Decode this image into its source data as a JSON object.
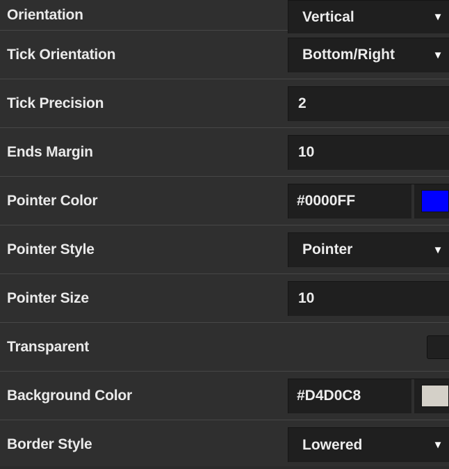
{
  "properties": [
    {
      "label": "Orientation",
      "type": "select",
      "value": "Vertical"
    },
    {
      "label": "Tick Orientation",
      "type": "select",
      "value": "Bottom/Right"
    },
    {
      "label": "Tick Precision",
      "type": "input",
      "value": "2"
    },
    {
      "label": "Ends Margin",
      "type": "input",
      "value": "10"
    },
    {
      "label": "Pointer Color",
      "type": "color",
      "value": "#0000FF",
      "swatch": "#0000FF"
    },
    {
      "label": "Pointer Style",
      "type": "select",
      "value": "Pointer"
    },
    {
      "label": "Pointer Size",
      "type": "input",
      "value": "10"
    },
    {
      "label": "Transparent",
      "type": "checkbox",
      "checked": false
    },
    {
      "label": "Background Color",
      "type": "color",
      "value": "#D4D0C8",
      "swatch": "#D4D0C8"
    },
    {
      "label": "Border Style",
      "type": "select",
      "value": "Lowered"
    }
  ],
  "icons": {
    "dropdown": "chevron-down-icon"
  },
  "colors": {
    "panel_bg": "#2F2F2F",
    "control_bg": "#1F1F1F",
    "row_divider": "#474747",
    "text": "#ECECEC"
  }
}
